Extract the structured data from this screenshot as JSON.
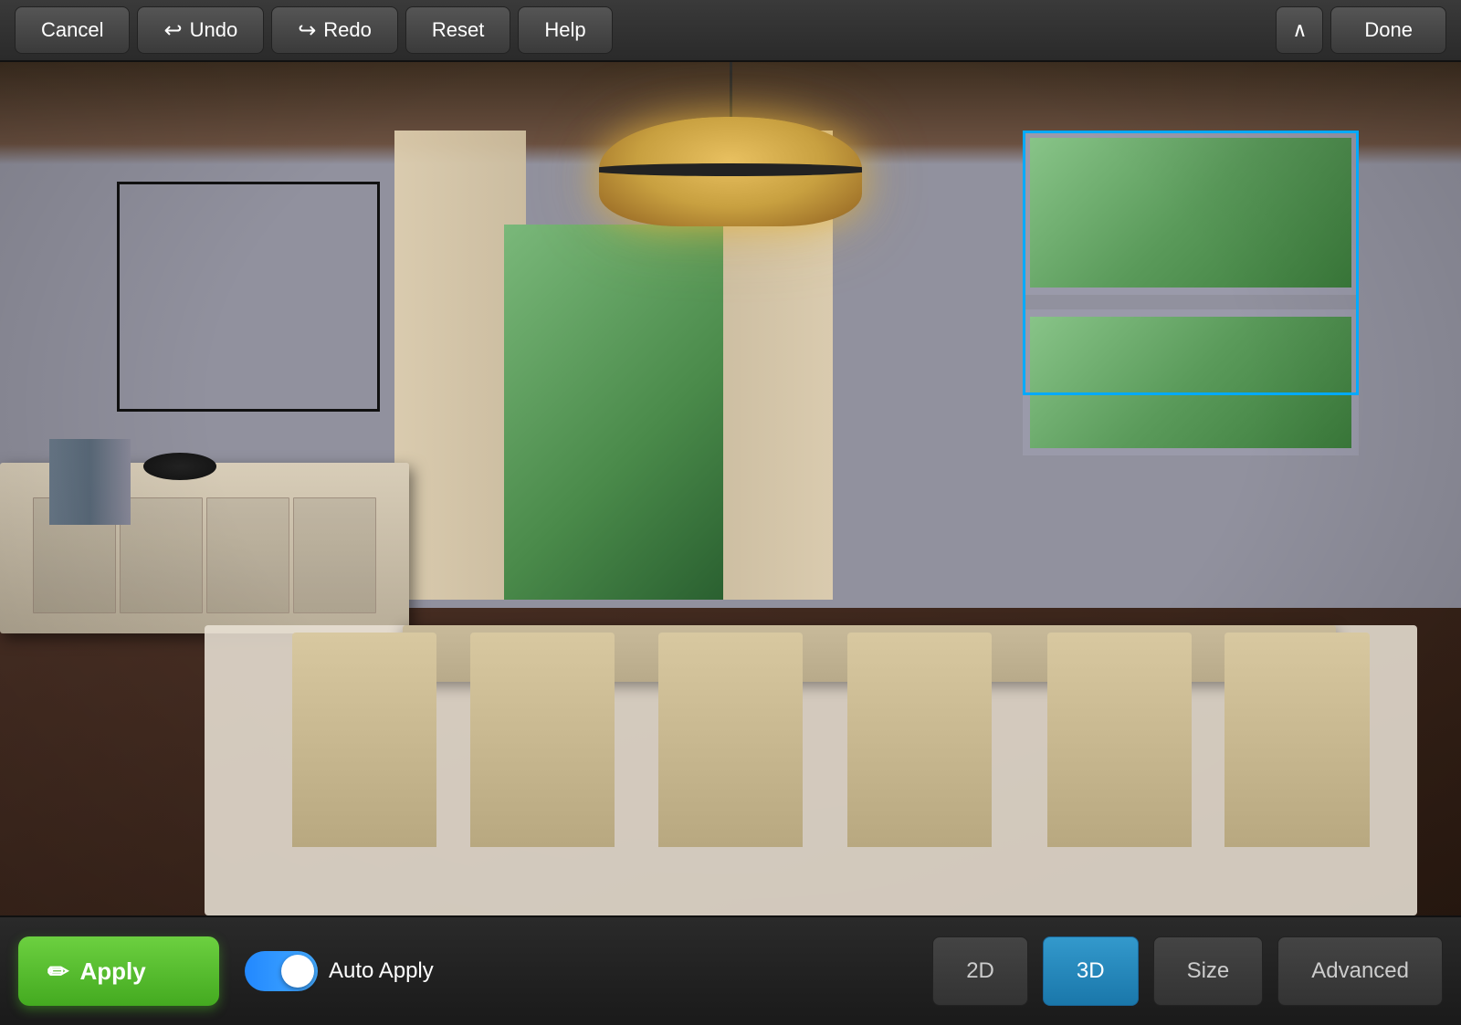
{
  "toolbar": {
    "cancel_label": "Cancel",
    "undo_label": "Undo",
    "redo_label": "Redo",
    "reset_label": "Reset",
    "help_label": "Help",
    "done_label": "Done",
    "chevron_label": "^"
  },
  "bottombar": {
    "apply_label": "Apply",
    "auto_apply_label": "Auto Apply",
    "btn_2d_label": "2D",
    "btn_3d_label": "3D",
    "size_label": "Size",
    "advanced_label": "Advanced",
    "toggle_state": "on"
  },
  "scene": {
    "selection_color": "#00aaff",
    "wall_color": "#91919e",
    "floor_color": "#2e1c12"
  },
  "icons": {
    "undo_icon": "↩",
    "redo_icon": "↪",
    "apply_icon": "✏"
  }
}
